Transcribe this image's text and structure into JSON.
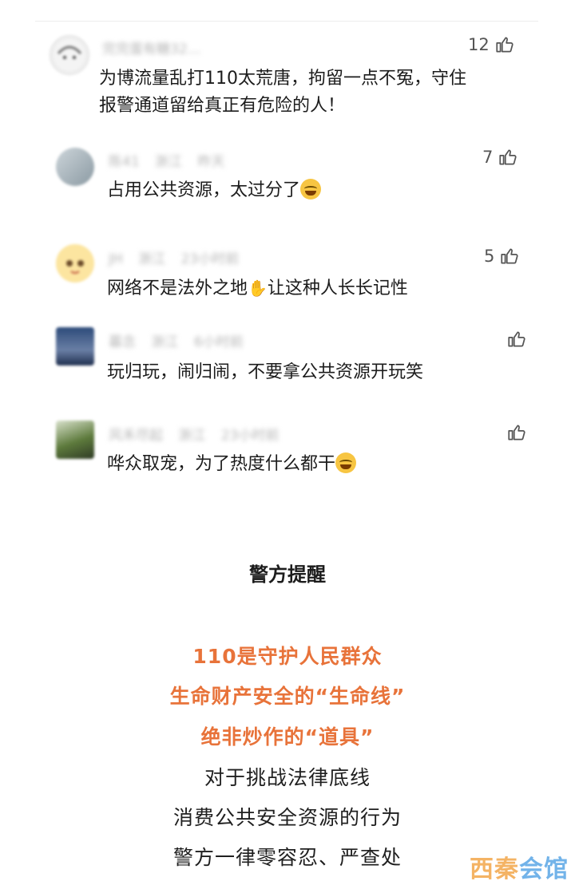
{
  "comments": [
    {
      "user": "完完蛋有糖32…",
      "location": "",
      "time": "",
      "text_line1": "为博流量乱打110太荒唐，拘留一点不冤，守住",
      "text_line2": "报警通道留给真正有危险的人！",
      "likes": "12"
    },
    {
      "user": "陈41",
      "location": "浙江",
      "time": "昨天",
      "text_line1": "占用公共资源，太过分了",
      "likes": "7"
    },
    {
      "user": "JH",
      "location": "浙江",
      "time": "23小时前",
      "text_line1": "网络不是法外之地",
      "text_line1b": "让这种人长长记性",
      "likes": "5"
    },
    {
      "user": "暮念",
      "location": "浙江",
      "time": "6小时前",
      "text_line1": "玩归玩，闹归闹，不要拿公共资源开玩笑",
      "likes": ""
    },
    {
      "user": "风禾尽起",
      "location": "浙江",
      "time": "23小时前",
      "text_line1": "哗众取宠，为了热度什么都干",
      "likes": ""
    }
  ],
  "notice": {
    "title": "警方提醒",
    "line1": "110是守护人民群众",
    "line2": "生命财产安全的“生命线”",
    "line3": "绝非炒作的“道具”",
    "line4": "对于挑战法律底线",
    "line5": "消费公共安全资源的行为",
    "line6": "警方一律零容忍、严查处"
  },
  "watermark": {
    "part1": "西秦",
    "part2": "会馆"
  },
  "colors": {
    "accent": "#e8733a",
    "watermark": "#f3a64a"
  }
}
